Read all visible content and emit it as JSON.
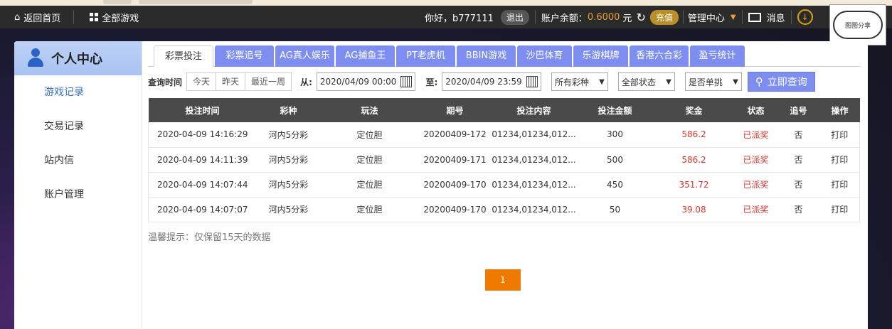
{
  "topbar": {
    "home": "返回首页",
    "all_games": "全部游戏",
    "greeting": "你好，b777111",
    "logout": "退出",
    "balance_label": "账户余额：",
    "balance_value": "0.6000",
    "balance_unit": "元",
    "recharge": "充值",
    "manage": "管理中心",
    "messages": "消息",
    "logo_text": "图图分享SHARE.COM"
  },
  "sidebar": {
    "title": "个人中心",
    "items": [
      {
        "label": "游戏记录"
      },
      {
        "label": "交易记录"
      },
      {
        "label": "站内信"
      },
      {
        "label": "账户管理"
      }
    ]
  },
  "tabs": [
    "彩票投注",
    "彩票追号",
    "AG真人娱乐",
    "AG捕鱼王",
    "PT老虎机",
    "BBIN游戏",
    "沙巴体育",
    "乐游棋牌",
    "香港六合彩",
    "盈亏统计"
  ],
  "filters": {
    "time_label": "查询时间",
    "quick": [
      "今天",
      "昨天",
      "最近一周"
    ],
    "from_label": "从:",
    "from_value": "2020/04/09 00:00",
    "to_label": "至:",
    "to_value": "2020/04/09 23:59",
    "lottery": "所有彩种",
    "status": "全部状态",
    "single": "是否单挑",
    "query": "立即查询"
  },
  "table": {
    "headers": [
      "投注时间",
      "彩种",
      "玩法",
      "期号",
      "投注内容",
      "投注金额",
      "奖金",
      "状态",
      "追号",
      "操作"
    ],
    "rows": [
      [
        "2020-04-09 14:16:29",
        "河内5分彩",
        "定位胆",
        "20200409-172",
        "01234,01234,012...",
        "300",
        "586.2",
        "已派奖",
        "否",
        "打印"
      ],
      [
        "2020-04-09 14:11:39",
        "河内5分彩",
        "定位胆",
        "20200409-171",
        "01234,01234,012...",
        "500",
        "586.2",
        "已派奖",
        "否",
        "打印"
      ],
      [
        "2020-04-09 14:07:44",
        "河内5分彩",
        "定位胆",
        "20200409-170",
        "01234,01234,012...",
        "450",
        "351.72",
        "已派奖",
        "否",
        "打印"
      ],
      [
        "2020-04-09 14:07:07",
        "河内5分彩",
        "定位胆",
        "20200409-170",
        "01234,01234,012...",
        "50",
        "39.08",
        "已派奖",
        "否",
        "打印"
      ]
    ]
  },
  "tip": "温馨提示：仅保留15天的数据",
  "page": "1"
}
